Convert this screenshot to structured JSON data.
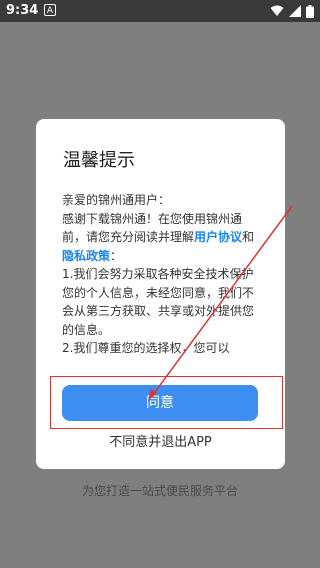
{
  "status_bar": {
    "time": "9:34",
    "notification_icon": "A"
  },
  "dialog": {
    "title": "温馨提示",
    "greeting": "亲爱的锦州通用户：",
    "para1_prefix": "感谢下载锦州通！在您使用锦州通前，请您充分阅读并理解",
    "link_user_agreement": "用户协议",
    "and": "和",
    "link_privacy_policy": "隐私政策",
    "para1_suffix": "：",
    "item1": "1.我们会努力采取各种安全技术保护您的个人信息，未经您同意，我们不会从第三方获取、共享或对外提供您的信息。",
    "item2": "2.我们尊重您的选择权，您可以",
    "agree_label": "同意",
    "decline_label": "不同意并退出APP"
  },
  "background": {
    "tagline": "为您打造一站式便民服务平台"
  },
  "colors": {
    "accent": "#3d8ef0",
    "link": "#1a86f0",
    "annotation": "#dd3333",
    "overlay": "#7f7f7f"
  },
  "icons": [
    "wifi-icon",
    "signal-icon",
    "battery-icon",
    "notification-icon"
  ]
}
